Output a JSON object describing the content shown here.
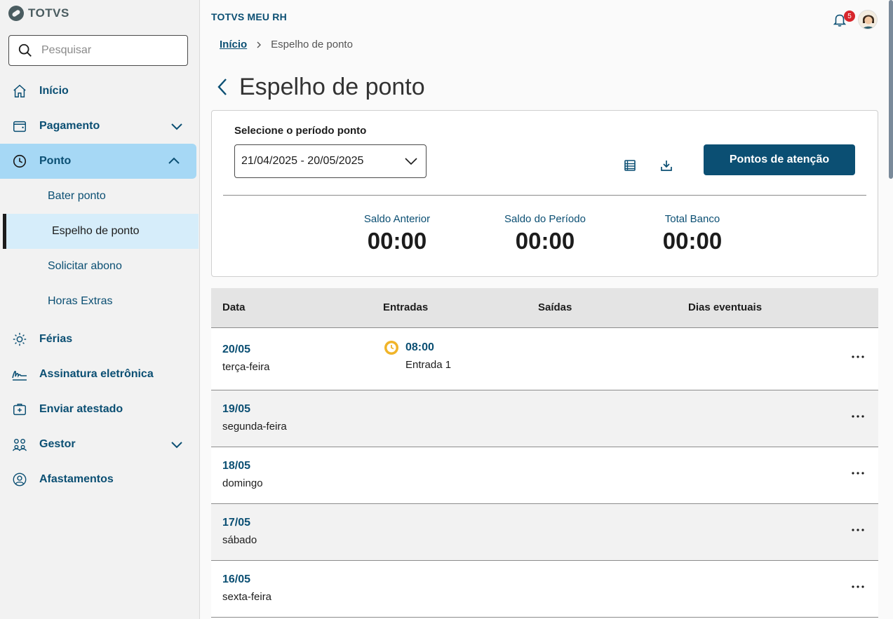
{
  "brand": {
    "name": "TOTVS"
  },
  "search": {
    "placeholder": "Pesquisar"
  },
  "sidebar": {
    "items": [
      {
        "label": "Início"
      },
      {
        "label": "Pagamento"
      },
      {
        "label": "Ponto"
      },
      {
        "label": "Férias"
      },
      {
        "label": "Assinatura eletrônica"
      },
      {
        "label": "Enviar atestado"
      },
      {
        "label": "Gestor"
      },
      {
        "label": "Afastamentos"
      }
    ],
    "ponto_sub": [
      {
        "label": "Bater ponto"
      },
      {
        "label": "Espelho de ponto"
      },
      {
        "label": "Solicitar abono"
      },
      {
        "label": "Horas Extras"
      }
    ]
  },
  "header": {
    "app_title": "TOTVS MEU RH",
    "notification_count": "5"
  },
  "breadcrumb": {
    "home": "Início",
    "current": "Espelho de ponto"
  },
  "page": {
    "title": "Espelho de ponto"
  },
  "period": {
    "label": "Selecione o período ponto",
    "value": "21/04/2025 - 20/05/2025"
  },
  "actions": {
    "attention_button": "Pontos de atenção"
  },
  "totals": [
    {
      "label": "Saldo Anterior",
      "value": "00:00"
    },
    {
      "label": "Saldo do Período",
      "value": "00:00"
    },
    {
      "label": "Total Banco",
      "value": "00:00"
    }
  ],
  "table": {
    "columns": [
      "Data",
      "Entradas",
      "Saídas",
      "Dias eventuais"
    ],
    "rows": [
      {
        "date": "20/05",
        "weekday": "terça-feira",
        "entry_time": "08:00",
        "entry_label": "Entrada 1"
      },
      {
        "date": "19/05",
        "weekday": "segunda-feira"
      },
      {
        "date": "18/05",
        "weekday": "domingo"
      },
      {
        "date": "17/05",
        "weekday": "sábado"
      },
      {
        "date": "16/05",
        "weekday": "sexta-feira"
      }
    ]
  },
  "colors": {
    "primary": "#0b4f73",
    "active_nav": "#a6d8f5",
    "badge": "#d7262c",
    "clock_icon": "#f0b429"
  }
}
